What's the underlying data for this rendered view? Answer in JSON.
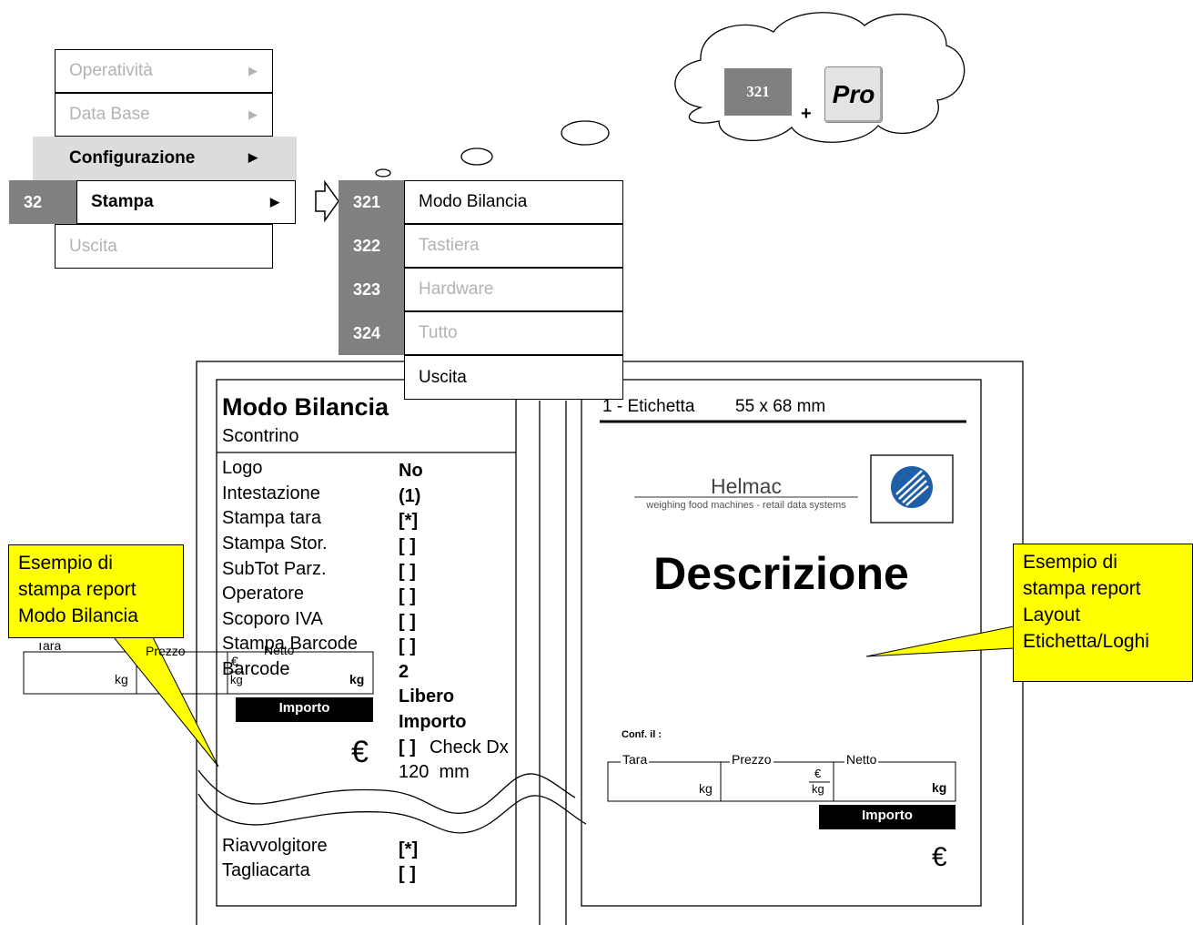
{
  "main_menu": {
    "items": [
      {
        "label": "Operatività",
        "arrow": "▶"
      },
      {
        "label": "Data Base",
        "arrow": "▶"
      },
      {
        "label": "Configurazione",
        "arrow": "▶"
      },
      {
        "label": "Stampa",
        "arrow": "▶",
        "code": "32"
      },
      {
        "label": "Uscita"
      }
    ]
  },
  "submenu": {
    "items": [
      {
        "code": "321",
        "label": "Modo Bilancia"
      },
      {
        "code": "322",
        "label": "Tastiera"
      },
      {
        "code": "323",
        "label": "Hardware"
      },
      {
        "code": "324",
        "label": "Tutto"
      },
      {
        "code": "",
        "label": "Uscita"
      }
    ]
  },
  "thought": {
    "code": "321",
    "plus": "+",
    "key_label": "Pro"
  },
  "report": {
    "title": "Modo Bilancia",
    "subtitle": "Scontrino",
    "rows": [
      {
        "label": "Logo",
        "value": "No"
      },
      {
        "label": "Intestazione",
        "value": "(1)"
      },
      {
        "label": "Stampa tara",
        "value": "[*]"
      },
      {
        "label": "Stampa Stor.",
        "value": "[ ]"
      },
      {
        "label": "SubTot Parz.",
        "value": "[ ]"
      },
      {
        "label": "Operatore",
        "value": "[ ]"
      },
      {
        "label": "Scoporo IVA",
        "value": "[ ]"
      },
      {
        "label": "Stampa Barcode",
        "value": "[ ]"
      },
      {
        "label": "Barcode",
        "value": "2"
      }
    ],
    "extra_values": [
      "Libero",
      "Importo"
    ],
    "check_value": "[ ]",
    "check_label": "Check Dx",
    "width_value": "120  mm",
    "bottom_rows": [
      {
        "label": "Riavvolgitore",
        "value": "[*]"
      },
      {
        "label": "Tagliacarta",
        "value": "[ ]"
      }
    ],
    "ticket": {
      "tara": "Tara",
      "prezzo": "Prezzo",
      "netto": "Netto",
      "kg": "kg",
      "euro": "€",
      "importo": "Importo"
    }
  },
  "label": {
    "header": "1 - Etichetta",
    "size": "55 x 68 mm",
    "brand": "Helmac",
    "tagline": "weighing food machines - retail data systems",
    "description": "Descrizione",
    "conf": "Conf. il :",
    "tara": "Tara",
    "prezzo": "Prezzo",
    "netto": "Netto",
    "kg": "kg",
    "euro": "€",
    "importo": "Importo"
  },
  "callouts": {
    "left": [
      "Esempio di",
      "stampa report",
      "Modo Bilancia"
    ],
    "right": [
      "Esempio di",
      "stampa report",
      "Layout",
      "Etichetta/Loghi"
    ]
  },
  "colors": {
    "code_bg": "#808080",
    "selected_bg": "#dcdcdc",
    "callout": "#ffff00",
    "logo_blue": "#1f5fa8"
  }
}
